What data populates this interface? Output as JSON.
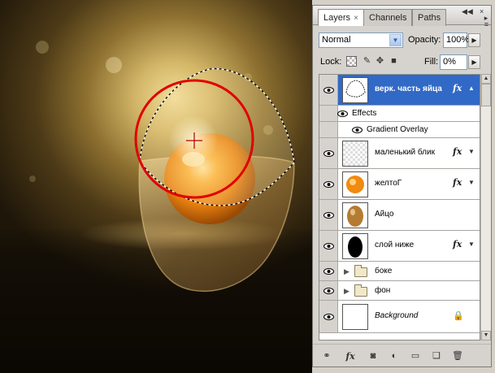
{
  "panel": {
    "tabs": [
      {
        "label": "Layers",
        "active": true,
        "close": "×"
      },
      {
        "label": "Channels",
        "active": false
      },
      {
        "label": "Paths",
        "active": false
      }
    ],
    "panel_controls": {
      "collapse": "◀◀",
      "close": "×",
      "menu_icon": "panel-menu-icon"
    },
    "blend_mode": "Normal",
    "opacity_label": "Opacity:",
    "opacity_value": "100%",
    "lock_label": "Lock:",
    "fill_label": "Fill:",
    "fill_value": "0%",
    "lock_icons": [
      "lock-transparent-icon",
      "lock-brush-icon",
      "lock-move-icon",
      "lock-all-icon"
    ]
  },
  "layers": [
    {
      "name": "верк. часть яйца",
      "selected": true,
      "fx": "fx",
      "thumb": "white-shape"
    },
    {
      "type": "effect",
      "name": "Effects"
    },
    {
      "type": "effect",
      "name": "Gradient Overlay"
    },
    {
      "name": "маленький блик",
      "fx": "fx",
      "thumb": "transparent"
    },
    {
      "name": "желтоГ",
      "fx": "fx",
      "thumb": "yolk"
    },
    {
      "name": "Айцо",
      "thumb": "egg"
    },
    {
      "name": "слой ниже",
      "fx": "fx",
      "thumb": "black-egg"
    },
    {
      "type": "group",
      "name": "боке"
    },
    {
      "type": "group",
      "name": "фон"
    },
    {
      "name": "Background",
      "thumb": "white",
      "locked": true
    }
  ],
  "bottom_icons": [
    "link-layers-icon",
    "add-style-icon",
    "add-mask-icon",
    "adjustment-layer-icon",
    "new-group-icon",
    "new-layer-icon",
    "delete-layer-icon"
  ],
  "colors": {
    "selection_blue": "#3169c6",
    "circle_red": "#e00000",
    "panel_bg": "#d6d3ce"
  }
}
